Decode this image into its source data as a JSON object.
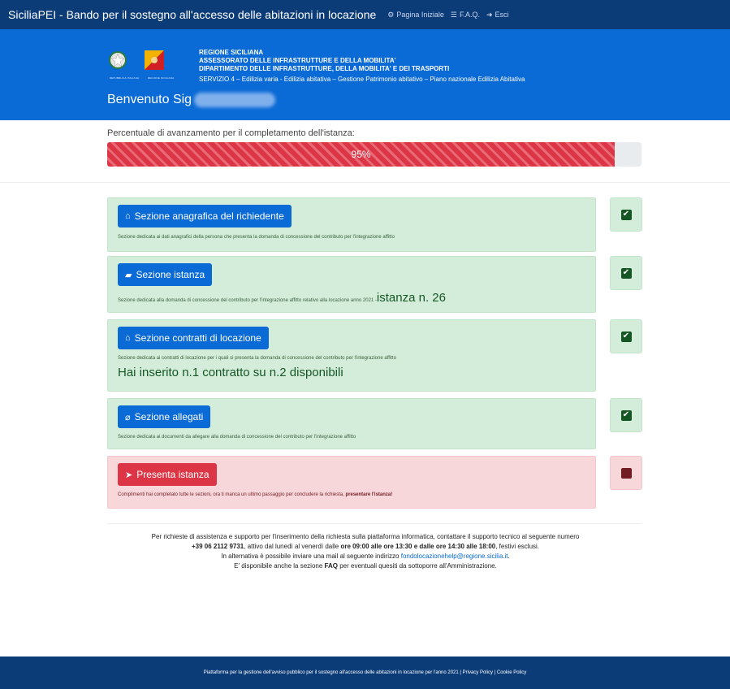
{
  "topbar": {
    "brand": "SiciliaPEI - Bando per il sostegno all'accesso delle abitazioni in locazione",
    "nav": [
      {
        "icon": "dashboard-icon",
        "glyph": "⚙",
        "label": "Pagina Iniziale"
      },
      {
        "icon": "list-icon",
        "glyph": "☰",
        "label": "F.A.Q."
      },
      {
        "icon": "sign-out-icon",
        "glyph": "➜",
        "label": "Esci"
      }
    ]
  },
  "banner": {
    "emblem1_caption": "Repubblica Italiana",
    "emblem2_caption": "Regione Siciliana",
    "org_line1": "REGIONE SICILIANA",
    "org_line2": "ASSESSORATO DELLE INFRASTRUTTURE E DELLA MOBILITA'",
    "org_line3": "DIPARTIMENTO DELLE INFRASTRUTTURE, DELLA MOBILITA' E DEI TRASPORTI",
    "service": "SERVIZIO 4 – Edilizia varia - Edilizia abitativa – Gestione Patrimonio abitativo – Piano nazionale Edilizia Abitativa",
    "welcome": "Benvenuto Sig"
  },
  "progress": {
    "label": "Percentuale di avanzamento per il completamento dell'istanza:",
    "value": 95,
    "text": "95%"
  },
  "sections": [
    {
      "button": "Sezione anagrafica del richiedente",
      "icon": "home-icon",
      "glyph": "⌂",
      "desc": "Sezione dedicata ai dati anagrafici della persona che presenta la domanda di concessione del contributo per l'integrazione affitto",
      "status": "complete",
      "status_glyph": "✔"
    },
    {
      "button": "Sezione istanza",
      "icon": "folder-open-icon",
      "glyph": "▰",
      "desc": "Sezione dedicata alla domanda di concessione del contributo per l'integrazione affitto relativo alla locazione anno 2021 - ",
      "extra": "istanza n. 26",
      "status": "complete",
      "status_glyph": "✔"
    },
    {
      "button": "Sezione contratti di locazione",
      "icon": "house-contract-icon",
      "glyph": "⌂",
      "desc": "Sezione dedicata ai contratti di locazione per i quali si presenta la domanda di concessione del contributo per l'integrazione affitto",
      "extra": "Hai inserito n.1 contratto su n.2 disponibili",
      "status": "complete",
      "status_glyph": "✔"
    },
    {
      "button": "Sezione allegati",
      "icon": "paperclip-icon",
      "glyph": "⌀",
      "desc": "Sezione dedicata ai documenti da allegare alla domanda di concessione del contributo per l'integrazione affitto",
      "status": "complete",
      "status_glyph": "✔"
    },
    {
      "button": "Presenta istanza",
      "icon": "paper-plane-icon",
      "glyph": "➤",
      "desc": "Complimenti hai completato tutte le sezioni, ora ti manca un ultimo passaggio per concludere la richiesta, ",
      "desc_bold": "presentare l'istanza!",
      "status": "incomplete",
      "status_glyph": ""
    }
  ],
  "support": {
    "line1": "Per richieste di assistenza e supporto per l'inserimento della richiesta sulla piattaforma informatica, contattare il supporto tecnico al seguente numero",
    "phone": "+39 06 2112 9731",
    "line2a": ", attivo dal lunedì al venerdì dalle ",
    "hours1": "ore 09:00 alle ore 13:30 e dalle ore 14:30 alle 18:00",
    "line2b": ", festivi esclusi.",
    "line3a": "In alternativa è possibile inviare una mail al seguente indirizzo ",
    "email": "fondolocazionehelp@regione.sicilia.it",
    "line3b": ".",
    "line4a": "E' disponibile anche la sezione ",
    "faq": "FAQ",
    "line4b": " per eventuali quesiti da sottoporre all'Amministrazione."
  },
  "footer": {
    "text": "Piattaforma per la gestione dell'avviso pubblico per il sostegno all'accesso delle abitazioni in locazione per l'anno 2021",
    "sep": " | ",
    "privacy": "Privacy Policy",
    "cookie": "Cookie Policy"
  }
}
